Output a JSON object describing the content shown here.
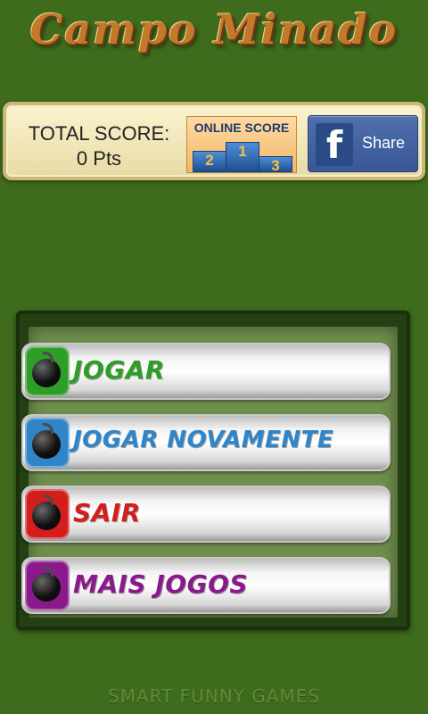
{
  "header": {
    "title": "Campo Minado"
  },
  "score": {
    "total_label": "TOTAL SCORE:",
    "total_value": "0 Pts",
    "online_label": "ONLINE SCORE",
    "podium": [
      "2",
      "1",
      "3"
    ]
  },
  "facebook": {
    "icon": "f",
    "share_label": "Share"
  },
  "menu": {
    "items": [
      {
        "label": "JOGAR",
        "color": "#2e9e28"
      },
      {
        "label": "JOGAR NOVAMENTE",
        "color": "#2f85c8"
      },
      {
        "label": "SAIR",
        "color": "#d41e1e"
      },
      {
        "label": "MAIS JOGOS",
        "color": "#8a1a8c"
      }
    ]
  },
  "footer": {
    "brand": "SMART FUNNY GAMES"
  }
}
